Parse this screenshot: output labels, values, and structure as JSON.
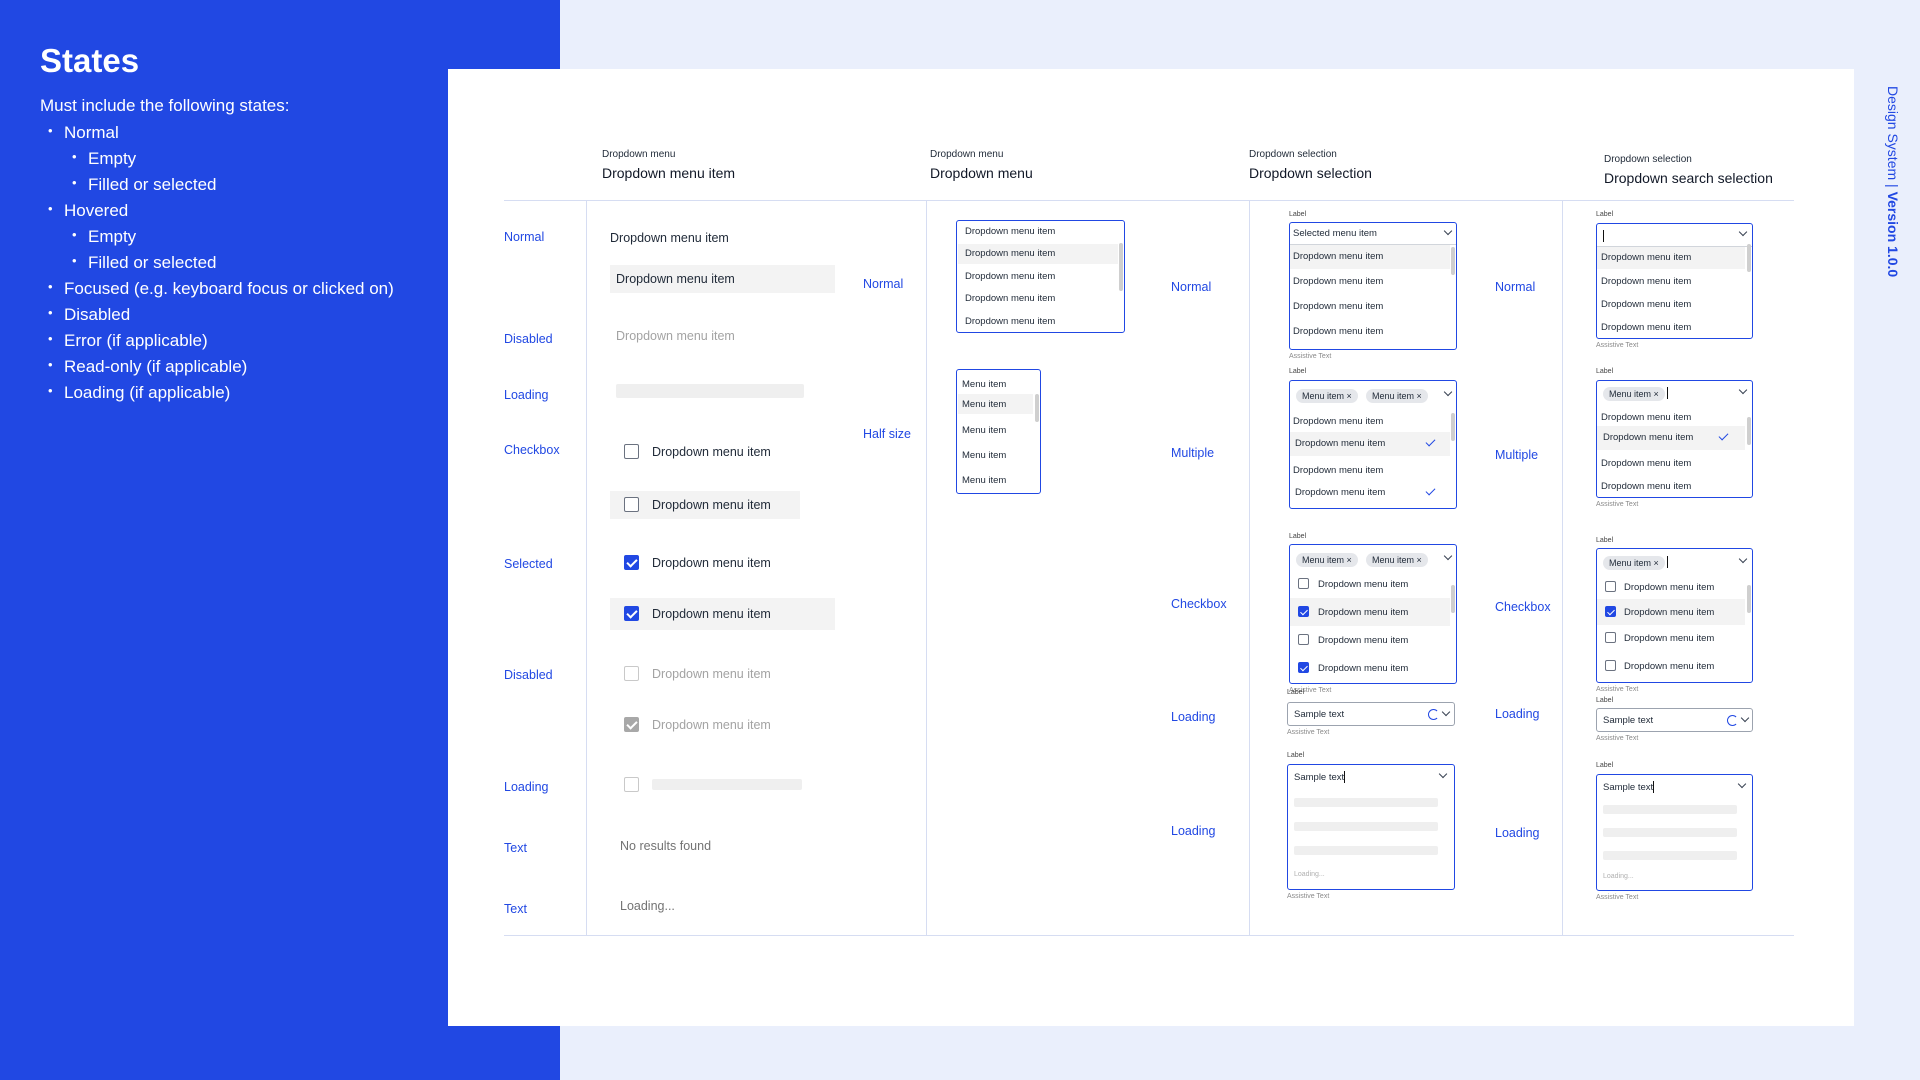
{
  "sidebar": {
    "title": "States",
    "intro": "Must include the following states:",
    "items": [
      "Normal",
      "Empty",
      "Filled or selected",
      "Hovered",
      "Empty",
      "Filled or selected",
      "Focused (e.g. keyboard focus or clicked on)",
      "Disabled",
      "Error (if applicable)",
      "Read-only (if applicable)",
      "Loading (if applicable)"
    ]
  },
  "side_tab": {
    "name": "Design System",
    "separator": "|",
    "version": "Version 1.0.0"
  },
  "columns": [
    {
      "small": "Dropdown menu",
      "large": "Dropdown menu item"
    },
    {
      "small": "Dropdown menu",
      "large": "Dropdown menu"
    },
    {
      "small": "Dropdown selection",
      "large": "Dropdown selection"
    },
    {
      "small": "Dropdown selection",
      "large": "Dropdown search selection"
    }
  ],
  "col1": {
    "labels": [
      "Normal",
      "Disabled",
      "Loading",
      "Checkbox",
      "Selected",
      "Disabled",
      "Loading",
      "Text",
      "Text"
    ],
    "item": "Dropdown menu item",
    "no_results": "No results found",
    "loading": "Loading..."
  },
  "col2": {
    "labels": [
      "Normal",
      "Half size"
    ],
    "list_item": "Dropdown menu item",
    "half_item": "Menu item"
  },
  "col3": {
    "labels": [
      "Normal",
      "Multiple",
      "Checkbox",
      "Loading",
      "Loading"
    ]
  },
  "col4": {
    "labels": [
      "Normal",
      "Multiple",
      "Checkbox",
      "Loading",
      "Loading"
    ]
  },
  "field": {
    "label": "Label",
    "assistive": "Assistive Text",
    "selected": "Selected menu item",
    "item": "Dropdown menu item",
    "chip": "Menu item",
    "chip_x": "×",
    "sample": "Sample text",
    "loading": "Loading..."
  },
  "colors": {
    "accent": "#2148E3",
    "panel_bg": "#EAEFFC",
    "card_bg": "#FFFFFF"
  }
}
